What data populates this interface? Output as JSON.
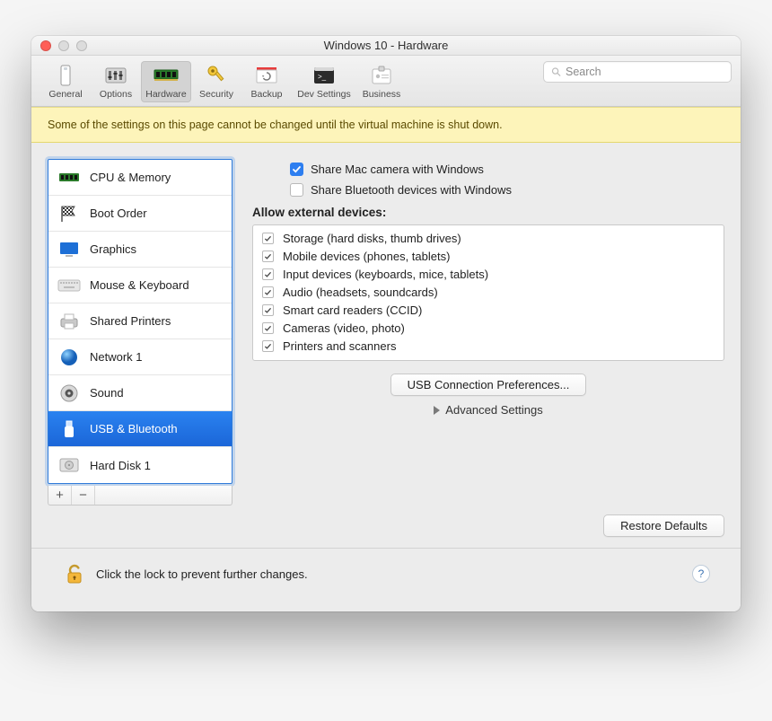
{
  "window": {
    "title": "Windows 10 - Hardware"
  },
  "toolbar": {
    "items": [
      {
        "label": "General"
      },
      {
        "label": "Options"
      },
      {
        "label": "Hardware"
      },
      {
        "label": "Security"
      },
      {
        "label": "Backup"
      },
      {
        "label": "Dev Settings"
      },
      {
        "label": "Business"
      }
    ],
    "active_index": 2,
    "search_placeholder": "Search"
  },
  "banner": "Some of the settings on this page cannot be changed until the virtual machine is shut down.",
  "sidebar": {
    "items": [
      {
        "label": "CPU & Memory"
      },
      {
        "label": "Boot Order"
      },
      {
        "label": "Graphics"
      },
      {
        "label": "Mouse & Keyboard"
      },
      {
        "label": "Shared Printers"
      },
      {
        "label": "Network 1"
      },
      {
        "label": "Sound"
      },
      {
        "label": "USB & Bluetooth"
      },
      {
        "label": "Hard Disk 1"
      }
    ],
    "selected_index": 7,
    "add": "+",
    "remove": "−"
  },
  "main": {
    "share_camera": {
      "label": "Share Mac camera with Windows",
      "checked": true
    },
    "share_bluetooth": {
      "label": "Share Bluetooth devices with Windows",
      "checked": false
    },
    "section_title": "Allow external devices:",
    "devices": [
      {
        "label": "Storage (hard disks, thumb drives)",
        "checked": true
      },
      {
        "label": "Mobile devices (phones, tablets)",
        "checked": true
      },
      {
        "label": "Input devices (keyboards, mice, tablets)",
        "checked": true
      },
      {
        "label": "Audio (headsets, soundcards)",
        "checked": true
      },
      {
        "label": "Smart card readers (CCID)",
        "checked": true
      },
      {
        "label": "Cameras (video, photo)",
        "checked": true
      },
      {
        "label": "Printers and scanners",
        "checked": true
      }
    ],
    "usb_prefs_button": "USB Connection Preferences...",
    "advanced": "Advanced Settings",
    "restore_defaults": "Restore Defaults"
  },
  "footer": {
    "lock_text": "Click the lock to prevent further changes.",
    "help": "?"
  }
}
